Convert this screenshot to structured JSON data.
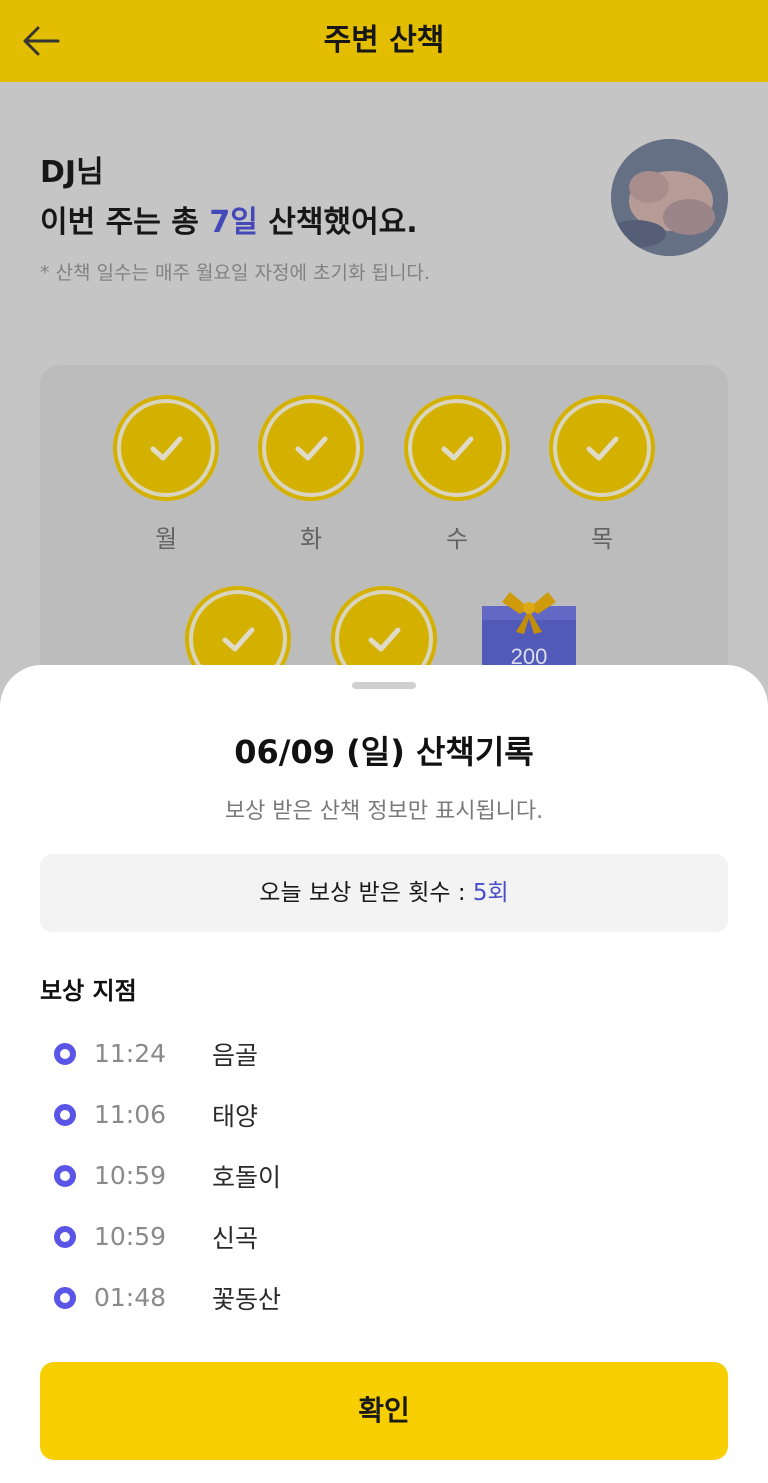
{
  "header": {
    "title": "주변 산책",
    "back_icon": "arrow-left-icon"
  },
  "summary": {
    "user_line": "DJ님",
    "line_prefix": "이번 주는 총 ",
    "days": "7일",
    "line_suffix": " 산책했어요.",
    "note": "* 산책 일수는 매주 월요일 자정에 초기화 됩니다."
  },
  "week": {
    "days": [
      {
        "label": "월",
        "checked": true
      },
      {
        "label": "화",
        "checked": true
      },
      {
        "label": "수",
        "checked": true
      },
      {
        "label": "목",
        "checked": true
      },
      {
        "checked": true
      },
      {
        "checked": true
      }
    ],
    "gift_points": "200"
  },
  "sheet": {
    "title": "06/09 (일) 산책기록",
    "subtitle": "보상 받은 산책 정보만 표시됩니다.",
    "count_label": "오늘 보상 받은 횟수 : ",
    "count_value": "5회",
    "section_title": "보상 지점",
    "rewards": [
      {
        "time": "11:24",
        "place": "음골"
      },
      {
        "time": "11:06",
        "place": "태양"
      },
      {
        "time": "10:59",
        "place": "호돌이"
      },
      {
        "time": "10:59",
        "place": "신곡"
      },
      {
        "time": "01:48",
        "place": "꽃동산"
      }
    ],
    "confirm_label": "확인"
  },
  "colors": {
    "brand": "#f7cf00",
    "accent": "#4a4fc9",
    "dot": "#5a55e6"
  }
}
